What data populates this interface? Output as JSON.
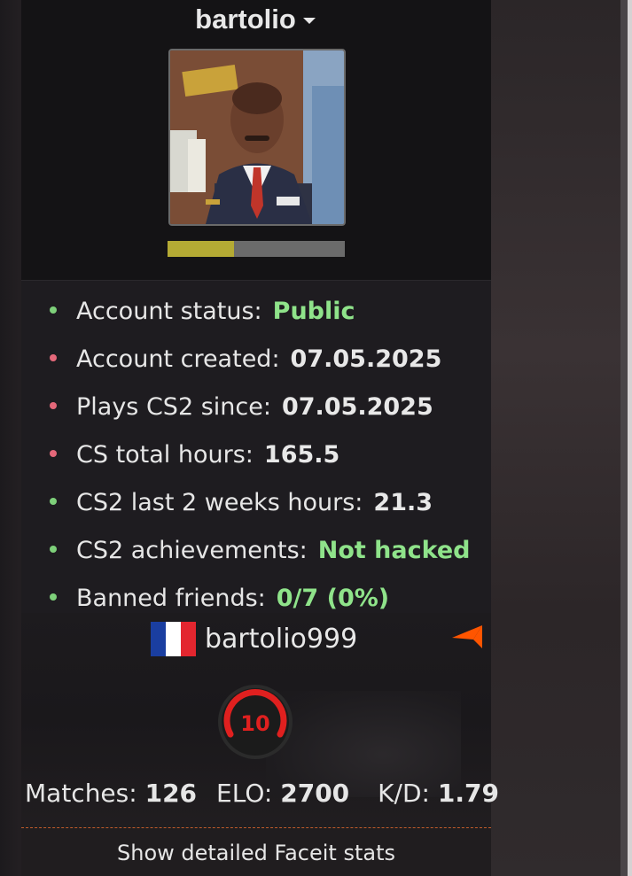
{
  "profile": {
    "username": "bartolio",
    "xp_progress_fraction": 0.375
  },
  "stats": [
    {
      "label": "Account status:",
      "value": "Public",
      "dot_color": "#7ed07a",
      "value_color": "green"
    },
    {
      "label": "Account created:",
      "value": "07.05.2025",
      "dot_color": "#e5687a",
      "value_color": "white"
    },
    {
      "label": "Plays CS2 since:",
      "value": "07.05.2025",
      "dot_color": "#e5687a",
      "value_color": "white"
    },
    {
      "label": "CS total hours:",
      "value": "165.5",
      "dot_color": "#e5687a",
      "value_color": "white"
    },
    {
      "label": "CS2 last 2 weeks hours:",
      "value": "21.3",
      "dot_color": "#7ed07a",
      "value_color": "white"
    },
    {
      "label": "CS2 achievements:",
      "value": "Not hacked",
      "dot_color": "#7ed07a",
      "value_color": "green"
    },
    {
      "label": "Banned friends:",
      "value": "0/7 (0%)",
      "dot_color": "#7ed07a",
      "value_color": "green"
    }
  ],
  "faceit": {
    "nickname": "bartolio999",
    "country_flag": "flag-france-icon",
    "level": "10",
    "matches_label": "Matches:",
    "matches": "126",
    "elo_label": "ELO:",
    "elo": "2700",
    "kd_label": "K/D:",
    "kd": "1.79",
    "detail_button": "Show detailed Faceit stats"
  },
  "colors": {
    "accent_green": "#8fe38a",
    "dot_red": "#e5687a",
    "progress_fill": "#b4aa34",
    "faceit_orange": "#ff5500"
  }
}
